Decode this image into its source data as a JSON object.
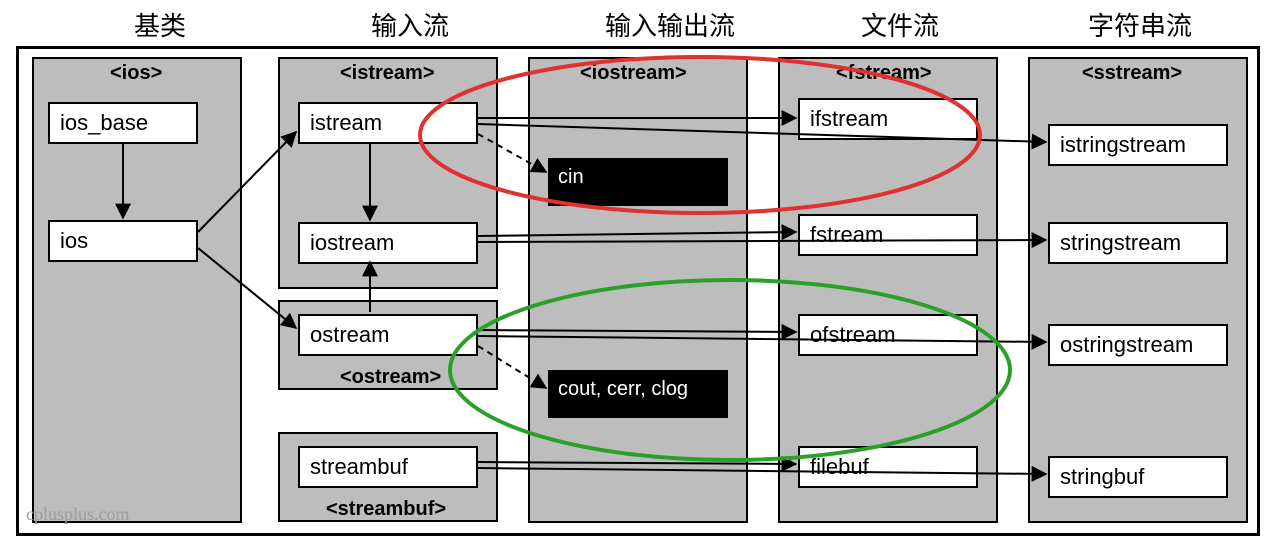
{
  "headers": {
    "col1": "基类",
    "col2": "输入流",
    "col3": "输入输出流",
    "col4": "文件流",
    "col5": "字符串流"
  },
  "groups": {
    "ios_title": "<ios>",
    "istream_title": "<istream>",
    "ostream_title": "<ostream>",
    "iostream_title": "<iostream>",
    "fstream_title": "<fstream>",
    "sstream_title": "<sstream>",
    "streambuf_title": "<streambuf>"
  },
  "nodes": {
    "ios_base": "ios_base",
    "ios": "ios",
    "istream": "istream",
    "iostream": "iostream",
    "ostream": "ostream",
    "streambuf": "streambuf",
    "cin": "cin",
    "cout_group": "cout, cerr, clog",
    "ifstream": "ifstream",
    "fstream": "fstream",
    "ofstream": "ofstream",
    "filebuf": "filebuf",
    "istringstream": "istringstream",
    "stringstream": "stringstream",
    "ostringstream": "ostringstream",
    "stringbuf": "stringbuf"
  },
  "watermark": "cplusplus.com",
  "annotations": {
    "red_ellipse": "istream → cin / ifstream grouping",
    "green_ellipse": "ostream → cout,cerr,clog / ofstream grouping"
  }
}
